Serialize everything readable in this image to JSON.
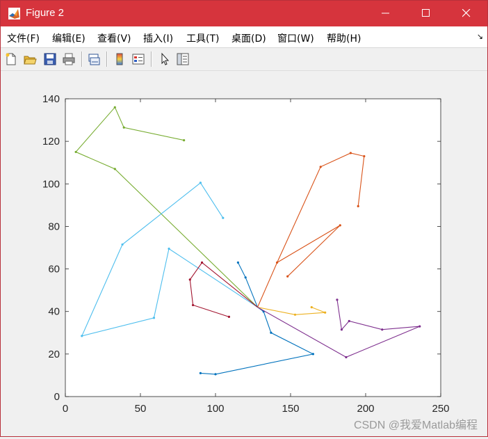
{
  "window": {
    "title": "Figure 2",
    "colors": {
      "titlebar": "#d6343d"
    }
  },
  "window_controls": [
    "minimize-icon",
    "maximize-icon",
    "close-icon"
  ],
  "menu": {
    "items": [
      "文件(F)",
      "编辑(E)",
      "查看(V)",
      "插入(I)",
      "工具(T)",
      "桌面(D)",
      "窗口(W)",
      "帮助(H)"
    ],
    "right_icon": "dock-arrow-icon"
  },
  "toolbar": {
    "icons": [
      "new-figure-icon",
      "open-file-icon",
      "save-icon",
      "print-icon",
      "link-plot-icon",
      "colorbar-icon",
      "legend-icon",
      "pointer-icon",
      "property-editor-icon"
    ]
  },
  "watermark": "CSDN @我爱Matlab编程",
  "chart_data": {
    "type": "line",
    "title": "",
    "xlabel": "",
    "ylabel": "",
    "xlim": [
      0,
      250
    ],
    "ylim": [
      0,
      140
    ],
    "xticks": [
      0,
      50,
      100,
      150,
      200,
      250
    ],
    "yticks": [
      0,
      20,
      40,
      60,
      80,
      100,
      120,
      140
    ],
    "grid": false,
    "legend": "none",
    "series": [
      {
        "color": "#0072BD",
        "x": [
          128,
          132,
          137,
          165,
          100,
          90
        ],
        "y": [
          42,
          40,
          30,
          20,
          10.5,
          11
        ]
      },
      {
        "color": "#0072BD",
        "x": [
          128,
          120,
          115
        ],
        "y": [
          42,
          56,
          63
        ]
      },
      {
        "color": "#D95319",
        "x": [
          128,
          141,
          170,
          190,
          199,
          195
        ],
        "y": [
          42,
          63,
          108,
          114.5,
          113,
          89.5
        ]
      },
      {
        "color": "#D95319",
        "x": [
          141,
          183,
          148
        ],
        "y": [
          63,
          80.5,
          56.5
        ]
      },
      {
        "color": "#EDB120",
        "x": [
          128,
          153,
          173,
          164
        ],
        "y": [
          42,
          38.5,
          39.5,
          42
        ]
      },
      {
        "color": "#7E2F8E",
        "x": [
          128,
          187,
          236,
          211,
          189,
          184,
          181
        ],
        "y": [
          42,
          18.5,
          33,
          31.5,
          35.5,
          31.5,
          45.5
        ]
      },
      {
        "color": "#77AC30",
        "x": [
          128,
          33,
          7,
          33,
          39,
          79
        ],
        "y": [
          42,
          107,
          115,
          136,
          126.5,
          120.5
        ]
      },
      {
        "color": "#4DBEEE",
        "x": [
          128,
          69,
          59,
          11,
          38,
          90,
          105
        ],
        "y": [
          42,
          69.5,
          37,
          28.5,
          71.5,
          100.5,
          84
        ]
      },
      {
        "color": "#A2142F",
        "x": [
          128,
          91,
          83,
          85,
          109
        ],
        "y": [
          42,
          63,
          55,
          43,
          37.5
        ]
      }
    ]
  }
}
